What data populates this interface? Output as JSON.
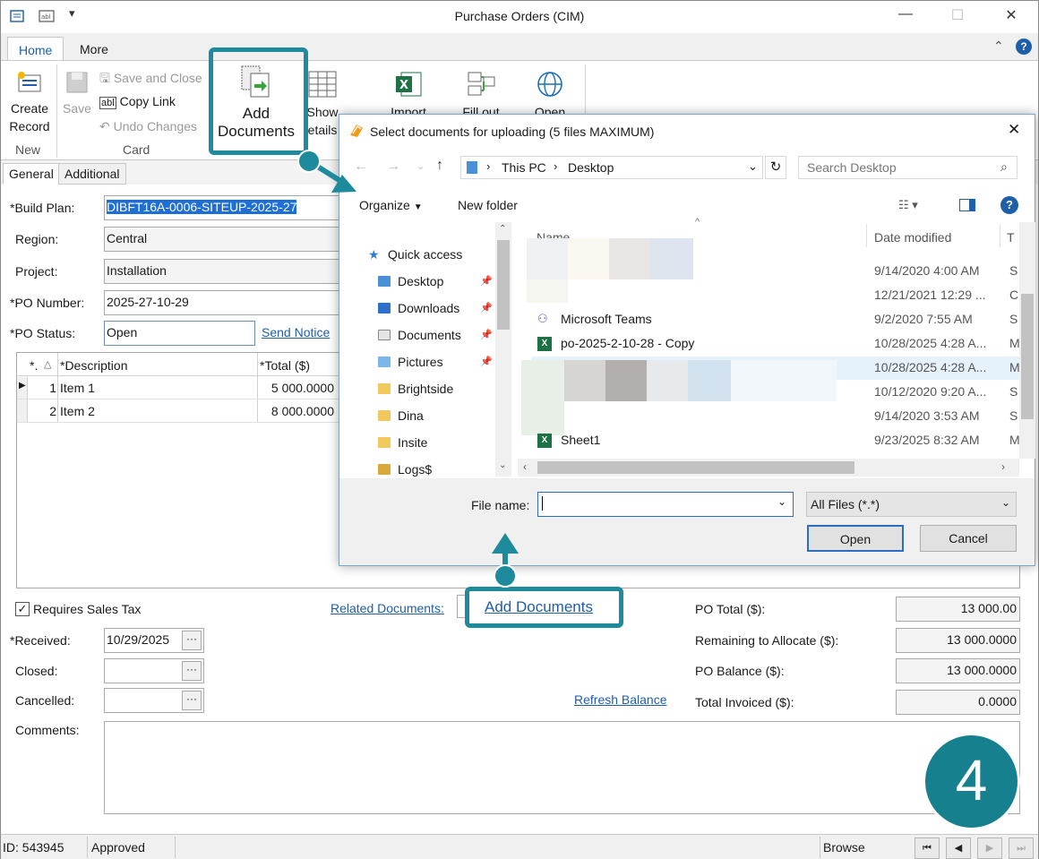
{
  "window": {
    "title": "Purchase Orders (CIM)"
  },
  "ribbon": {
    "tabs": [
      "Home",
      "More"
    ],
    "create_record": "Create\nRecord",
    "create_record_line1": "Create",
    "create_record_line2": "Record",
    "group_new": "New",
    "save": "Save",
    "save_and_close": "Save and Close",
    "copy_link": "Copy Link",
    "undo_changes": "Undo Changes",
    "group_card": "Card",
    "add_documents_line1": "Add",
    "add_documents_line2": "Documents",
    "show_details_line1": "Show",
    "show_details_line2": "etails",
    "import": "Import",
    "fill_out": "Fill out",
    "open": "Open"
  },
  "form_tabs": [
    "General",
    "Additional"
  ],
  "form": {
    "build_plan_label": "*Build Plan:",
    "build_plan_value": "DIBFT16A-0006-SITEUP-2025-27",
    "region_label": "Region:",
    "region_value": "Central",
    "project_label": "Project:",
    "project_value": "Installation",
    "po_number_label": "*PO Number:",
    "po_number_value": "2025-27-10-29",
    "po_status_label": "*PO Status:",
    "po_status_value": "Open",
    "send_notice": "Send Notice",
    "requires_sales_tax": "Requires Sales Tax",
    "related_documents": "Related Documents:",
    "add_documents_link": "Add Documents",
    "received_label": "*Received:",
    "received_value": "10/29/2025",
    "closed_label": "Closed:",
    "closed_value": "",
    "cancelled_label": "Cancelled:",
    "cancelled_value": "",
    "refresh_balance": "Refresh Balance",
    "comments_label": "Comments:",
    "po_total_label": "PO Total ($):",
    "po_total_value": "13 000.00",
    "remaining_label": "Remaining to Allocate ($):",
    "remaining_value": "13 000.0000",
    "po_balance_label": "PO Balance ($):",
    "po_balance_value": "13 000.0000",
    "total_invoiced_label": "Total Invoiced ($):",
    "total_invoiced_value": "0.0000"
  },
  "grid": {
    "columns": [
      "*.",
      "*Description",
      "*Total ($)"
    ],
    "rows": [
      {
        "num": "1",
        "description": "Item 1",
        "total": "5 000.0000"
      },
      {
        "num": "2",
        "description": "Item 2",
        "total": "8 000.0000"
      }
    ]
  },
  "status_bar": {
    "id": "ID: 543945",
    "status": "Approved",
    "mode": "Browse"
  },
  "dialog": {
    "title": "Select documents for uploading (5 files MAXIMUM)",
    "path_this_pc": "This PC",
    "path_desktop": "Desktop",
    "search_placeholder": "Search Desktop",
    "organize": "Organize",
    "new_folder": "New folder",
    "nav": [
      {
        "label": "Quick access"
      },
      {
        "label": "Desktop"
      },
      {
        "label": "Downloads"
      },
      {
        "label": "Documents"
      },
      {
        "label": "Pictures"
      },
      {
        "label": "Brightside"
      },
      {
        "label": "Dina"
      },
      {
        "label": "Insite"
      },
      {
        "label": "Logs$"
      }
    ],
    "col_name": "Name",
    "col_date": "Date modified",
    "col_type": "T",
    "files": [
      {
        "name": "",
        "date": "9/14/2020 4:00 AM",
        "type": "S"
      },
      {
        "name": "",
        "date": "12/21/2021 12:29 ...",
        "type": "C"
      },
      {
        "name": "Microsoft Teams",
        "date": "9/2/2020 7:55 AM",
        "type": "S"
      },
      {
        "name": "po-2025-2-10-28 - Copy",
        "date": "10/28/2025 4:28 A...",
        "type": "M"
      },
      {
        "name": "",
        "date": "10/28/2025 4:28 A...",
        "type": "M"
      },
      {
        "name": "",
        "date": "10/12/2020 9:20 A...",
        "type": "S"
      },
      {
        "name": "",
        "date": "9/14/2020 3:53 AM",
        "type": "S"
      },
      {
        "name": "Sheet1",
        "date": "9/23/2025 8:32 AM",
        "type": "M"
      }
    ],
    "file_name_label": "File name:",
    "file_name_value": "",
    "file_type": "All Files (*.*)",
    "open_button": "Open",
    "cancel_button": "Cancel"
  },
  "annotation": {
    "step_number": "4",
    "accent_color": "#1d8b9c"
  }
}
